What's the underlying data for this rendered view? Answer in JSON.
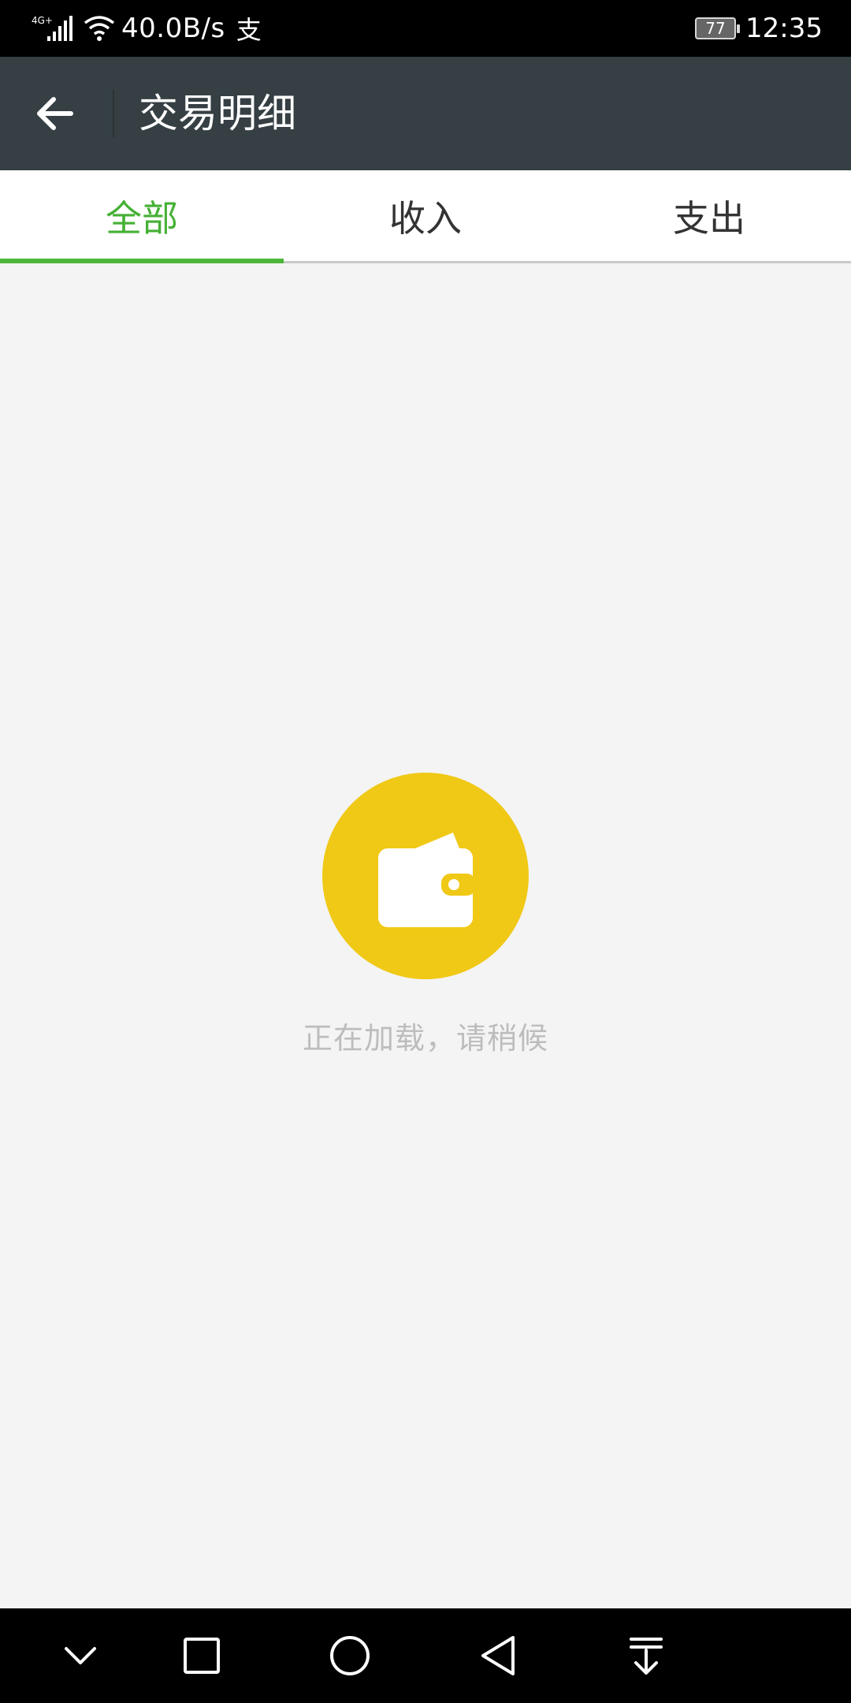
{
  "status_bar": {
    "network_type": "4G+",
    "net_speed": "40.0B/s",
    "app_notice": "支",
    "battery_level": "77",
    "time": "12:35"
  },
  "header": {
    "title": "交易明细"
  },
  "tabs": [
    {
      "label": "全部",
      "active": true
    },
    {
      "label": "收入",
      "active": false
    },
    {
      "label": "支出",
      "active": false
    }
  ],
  "loading": {
    "text": "正在加载，请稍候"
  },
  "colors": {
    "toolbar_bg": "#353f44",
    "accent_green": "#45b035",
    "wallet_yellow": "#f0c816",
    "page_bg": "#f4f4f4"
  },
  "icons": {
    "back": "arrow-left-icon",
    "wallet": "wallet-icon",
    "nav": [
      "chevron-down-icon",
      "square-icon",
      "circle-icon",
      "triangle-back-icon",
      "download-menu-icon"
    ]
  }
}
